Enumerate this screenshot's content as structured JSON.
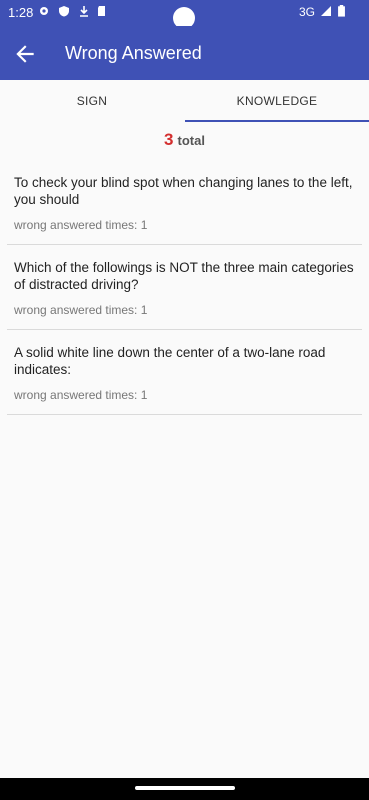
{
  "status_bar": {
    "time": "1:28",
    "network": "3G"
  },
  "app_bar": {
    "title": "Wrong Answered"
  },
  "tabs": [
    {
      "label": "SIGN",
      "selected": false
    },
    {
      "label": "KNOWLEDGE",
      "selected": true
    }
  ],
  "summary": {
    "count": "3",
    "label": "total"
  },
  "items": [
    {
      "question": "To check your blind spot when changing lanes to the left, you should",
      "times": "wrong answered times: 1"
    },
    {
      "question": "Which of the followings is NOT the three main categories of distracted driving?",
      "times": "wrong answered times: 1"
    },
    {
      "question": "A solid white line down the center of a two-lane road indicates:",
      "times": "wrong answered times: 1"
    }
  ],
  "colors": {
    "primary": "#3f51b5",
    "count": "#d32f2f"
  }
}
